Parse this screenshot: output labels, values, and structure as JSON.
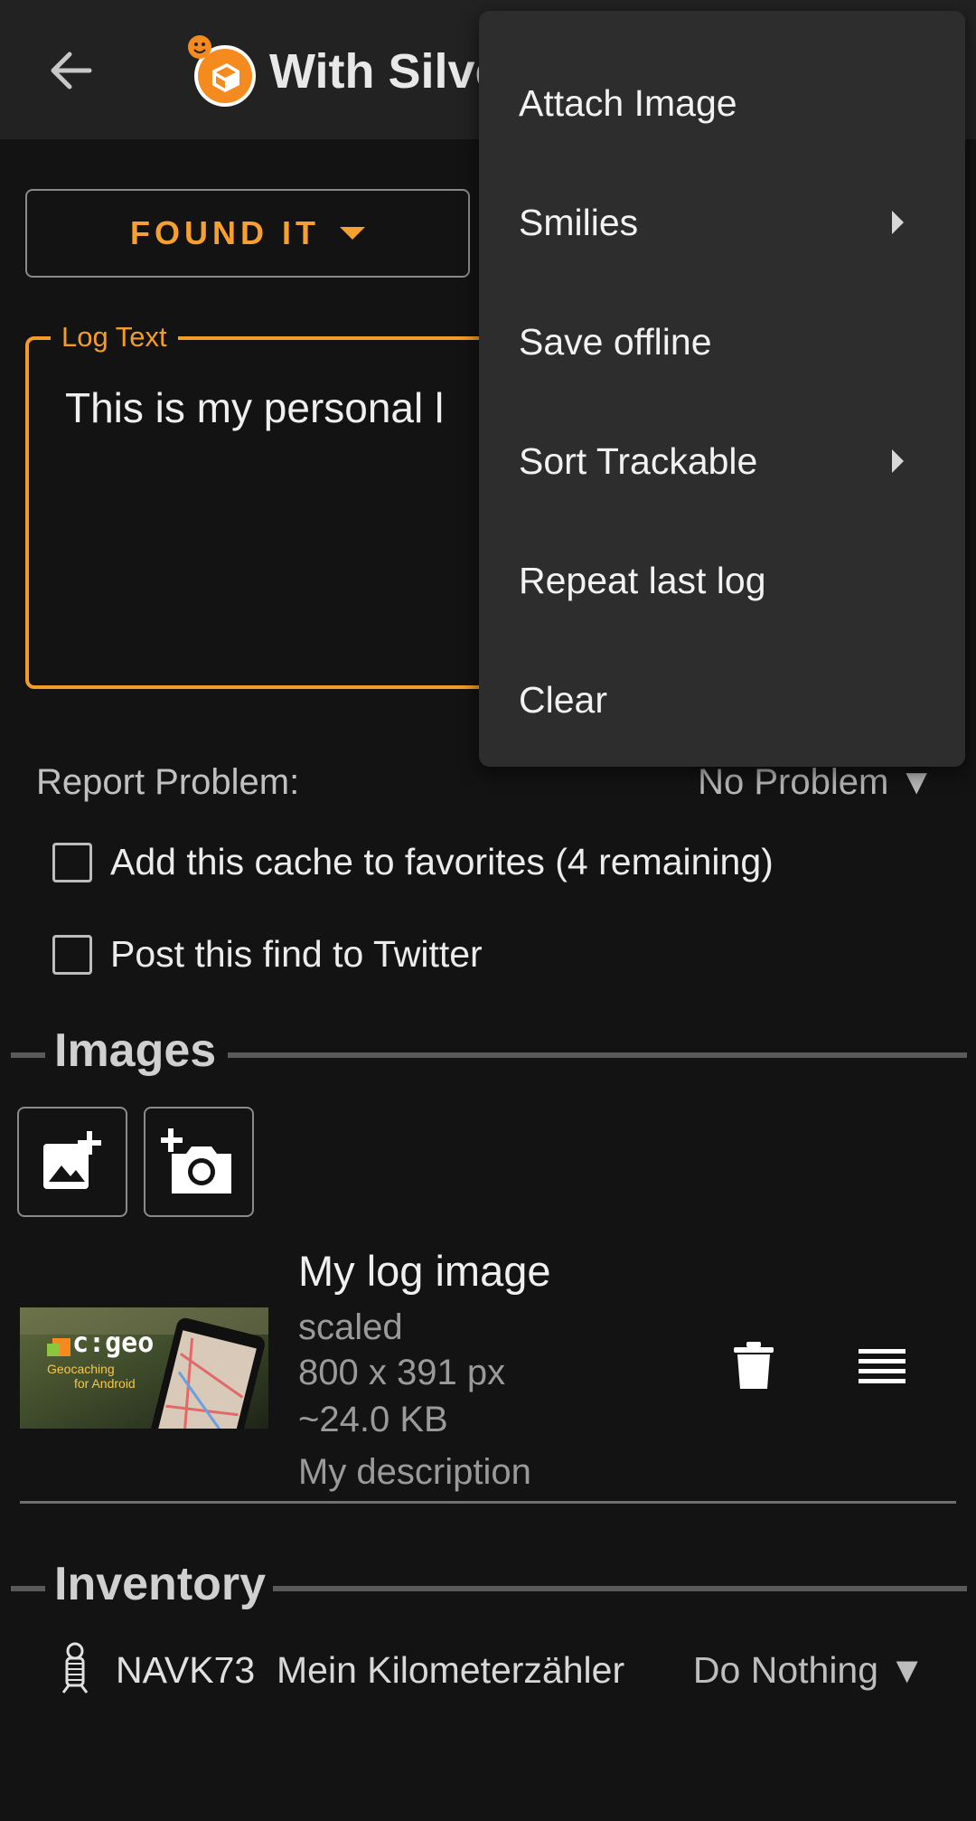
{
  "appbar": {
    "title": "With Silve",
    "back_icon": "arrow-left-icon",
    "logo_icon": "cgeo-cache-icon"
  },
  "log": {
    "type_label": "FOUND IT",
    "text_label": "Log Text",
    "text_value": "This is my personal l"
  },
  "report": {
    "label": "Report Problem:",
    "value": "No Problem ▼"
  },
  "options": {
    "favorite_label": "Add this cache to favorites (4 remaining)",
    "twitter_label": "Post this find to Twitter"
  },
  "images": {
    "section_title": "Images",
    "entry": {
      "title": "My log image",
      "scale": "scaled",
      "dimensions": "800 x 391 px",
      "size": "~24.0 KB",
      "description": "My description",
      "thumb_text": "c:geo",
      "thumb_subtitle_1": "Geocaching",
      "thumb_subtitle_2": "for Android"
    }
  },
  "inventory": {
    "section_title": "Inventory",
    "item": {
      "code": "NAVK73",
      "name": "Mein Kilometerzähler",
      "action": "Do Nothing ▼"
    }
  },
  "menu": {
    "items": [
      {
        "label": "Attach Image",
        "submenu": false
      },
      {
        "label": "Smilies",
        "submenu": true
      },
      {
        "label": "Save offline",
        "submenu": false
      },
      {
        "label": "Sort Trackable",
        "submenu": true
      },
      {
        "label": "Repeat last log",
        "submenu": false
      },
      {
        "label": "Clear",
        "submenu": false
      }
    ]
  },
  "colors": {
    "accent": "#f39c27",
    "background": "#131313",
    "appbar": "#222222",
    "menu": "#2d2d2d"
  }
}
